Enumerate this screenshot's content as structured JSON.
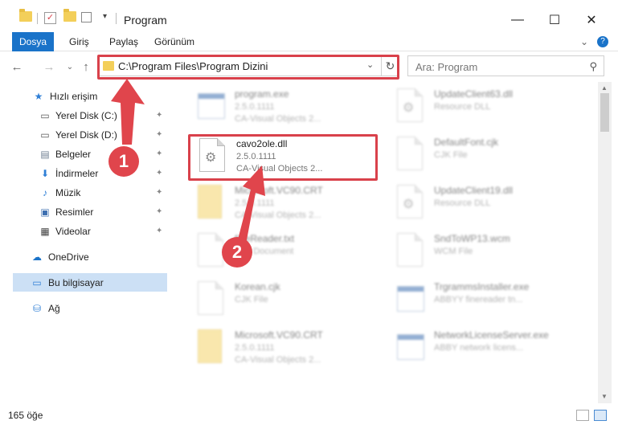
{
  "window": {
    "title": "Program",
    "minimize_glyph": "—",
    "maximize_glyph": "☐",
    "close_glyph": "✕"
  },
  "ribbon": {
    "tabs": [
      {
        "label": "Dosya",
        "active": true
      },
      {
        "label": "Giriş"
      },
      {
        "label": "Paylaş"
      },
      {
        "label": "Görünüm"
      }
    ],
    "expand_glyph": "⌄",
    "help_glyph": "?"
  },
  "nav": {
    "back_glyph": "←",
    "forward_glyph": "→",
    "recent_glyph": "⌄",
    "up_glyph": "↑"
  },
  "address": {
    "path": "C:\\Program Files\\Program Dizini",
    "dropdown_glyph": "⌄",
    "refresh_glyph": "↻"
  },
  "search": {
    "placeholder": "Ara: Program",
    "icon_glyph": "⚲"
  },
  "sidebar": {
    "items": [
      {
        "label": "Hızlı erişim",
        "icon": "star-icon",
        "glyph": "★",
        "color": "#2f7fd6"
      },
      {
        "label": "Yerel Disk (C:)",
        "icon": "drive-icon",
        "glyph": "▭",
        "color": "#555555",
        "pinned": true
      },
      {
        "label": "Yerel Disk (D:)",
        "icon": "drive-icon",
        "glyph": "▭",
        "color": "#555555",
        "pinned": true
      },
      {
        "label": "Belgeler",
        "icon": "documents-icon",
        "glyph": "▤",
        "color": "#6f7f92",
        "pinned": true
      },
      {
        "label": "İndirmeler",
        "icon": "download-icon",
        "glyph": "⬇",
        "color": "#2f7fd6",
        "pinned": true
      },
      {
        "label": "Müzik",
        "icon": "music-icon",
        "glyph": "♪",
        "color": "#2f7fd6",
        "pinned": true
      },
      {
        "label": "Resimler",
        "icon": "pictures-icon",
        "glyph": "▣",
        "color": "#3d6fb0",
        "pinned": true
      },
      {
        "label": "Videolar",
        "icon": "video-icon",
        "glyph": "▦",
        "color": "#444444",
        "pinned": true
      },
      {
        "label": "OneDrive",
        "icon": "cloud-icon",
        "glyph": "☁",
        "color": "#1a73c9"
      },
      {
        "label": "Bu bilgisayar",
        "icon": "computer-icon",
        "glyph": "▭",
        "color": "#2f7fd6",
        "selected": true
      },
      {
        "label": "Ağ",
        "icon": "network-icon",
        "glyph": "⛁",
        "color": "#2f7fd6"
      }
    ],
    "pin_glyph": "📌"
  },
  "files": [
    {
      "name": "program.exe",
      "meta1": "2.5.0.1111",
      "meta2": "CA-Visual Objects 2...",
      "kind": "exe",
      "col": 0,
      "row": 0,
      "blurred": true
    },
    {
      "name": "cavo2ole.dll",
      "meta1": "2.5.0.1111",
      "meta2": "CA-Visual Objects 2...",
      "kind": "dll",
      "col": 0,
      "row": 1,
      "blurred": false
    },
    {
      "name": "Microsoft.VC90.CRT",
      "meta1": "2.5.0.1111",
      "meta2": "CA-Visual Objects 2...",
      "kind": "folder",
      "col": 0,
      "row": 2,
      "blurred": true
    },
    {
      "name": "fineReader.txt",
      "meta1": "Text Document",
      "meta2": "",
      "kind": "doc",
      "col": 0,
      "row": 3,
      "blurred": true
    },
    {
      "name": "Korean.cjk",
      "meta1": "CJK File",
      "meta2": "",
      "kind": "doc",
      "col": 0,
      "row": 4,
      "blurred": true
    },
    {
      "name": "Microsoft.VC90.CRT",
      "meta1": "2.5.0.1111",
      "meta2": "CA-Visual Objects 2...",
      "kind": "folder",
      "col": 0,
      "row": 5,
      "blurred": true
    },
    {
      "name": "UpdateClient63.dll",
      "meta1": "Resource DLL",
      "meta2": "",
      "kind": "dll",
      "col": 1,
      "row": 0,
      "blurred": true
    },
    {
      "name": "DefaultFont.cjk",
      "meta1": "CJK File",
      "meta2": "",
      "kind": "doc",
      "col": 1,
      "row": 1,
      "blurred": true
    },
    {
      "name": "UpdateClient19.dll",
      "meta1": "Resource DLL",
      "meta2": "",
      "kind": "dll",
      "col": 1,
      "row": 2,
      "blurred": true
    },
    {
      "name": "SndToWP13.wcm",
      "meta1": "WCM File",
      "meta2": "",
      "kind": "doc",
      "col": 1,
      "row": 3,
      "blurred": true
    },
    {
      "name": "TrgrammsInstaller.exe",
      "meta1": "ABBYY finereader tn...",
      "meta2": "",
      "kind": "exe",
      "col": 1,
      "row": 4,
      "blurred": true
    },
    {
      "name": "NetworkLicenseServer.exe",
      "meta1": "ABBY network licens...",
      "meta2": "",
      "kind": "exe",
      "col": 1,
      "row": 5,
      "blurred": true
    }
  ],
  "annotations": [
    {
      "number": "1",
      "target": "address-bar"
    },
    {
      "number": "2",
      "target": "cavo2ole.dll"
    }
  ],
  "colors": {
    "accent": "#1a73c9",
    "highlight": "#d9414b",
    "selected": "#cce0f5"
  },
  "status": {
    "item_count": "165 öğe"
  }
}
